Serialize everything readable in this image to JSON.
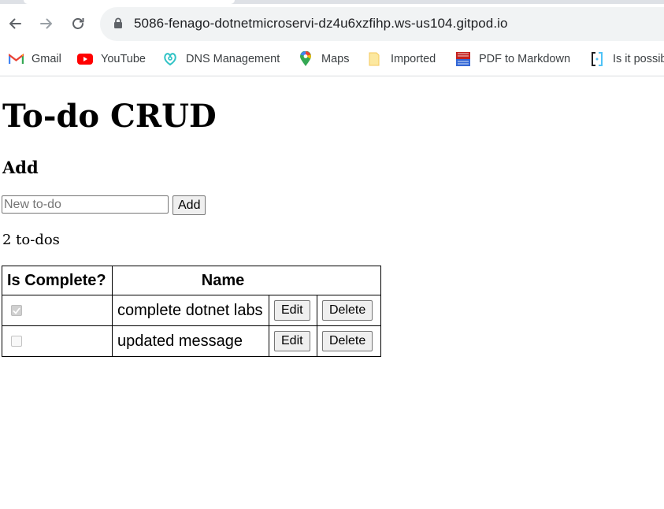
{
  "browser": {
    "url": "5086-fenago-dotnetmicroservi-dz4u6xzfihp.ws-us104.gitpod.io",
    "bookmarks": [
      {
        "label": "Gmail",
        "icon": "gmail-icon"
      },
      {
        "label": "YouTube",
        "icon": "youtube-icon"
      },
      {
        "label": "DNS Management",
        "icon": "dns-icon"
      },
      {
        "label": "Maps",
        "icon": "maps-icon"
      },
      {
        "label": "Imported",
        "icon": "folder-icon"
      },
      {
        "label": "PDF to Markdown",
        "icon": "pdf-icon"
      },
      {
        "label": "Is it possib",
        "icon": "bracket-icon"
      }
    ]
  },
  "page": {
    "title": "To-do CRUD",
    "add_heading": "Add",
    "input_placeholder": "New to-do",
    "add_button": "Add",
    "count_text": "2 to-dos",
    "table": {
      "headers": [
        "Is Complete?",
        "Name"
      ],
      "rows": [
        {
          "complete": true,
          "name": "complete dotnet labs",
          "edit": "Edit",
          "delete": "Delete"
        },
        {
          "complete": false,
          "name": "updated message",
          "edit": "Edit",
          "delete": "Delete"
        }
      ]
    }
  }
}
